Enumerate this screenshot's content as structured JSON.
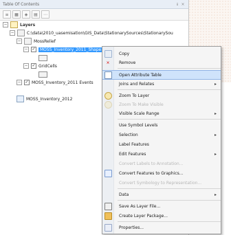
{
  "window": {
    "title": "Table Of Contents"
  },
  "tree": {
    "layers_label": "Layers",
    "path_label": "C:\\data\\2010_uasemisation\\GIS_Data\\StationarySources\\StationarySou",
    "mossrelief_label": "MossRelief",
    "selected_layer_label": "MOSS_Inventory_2011_Shape...",
    "gridcells_label": "GridCells",
    "layer_events_label": "MOSS_Inventory_2011 Events",
    "layer_plain_label": "MOSS_Inventory_2012"
  },
  "menu": {
    "items": [
      {
        "label": "Copy"
      },
      {
        "label": "Remove"
      },
      {
        "label": "Open Attribute Table"
      },
      {
        "label": "Joins and Relates"
      },
      {
        "label": "Zoom To Layer"
      },
      {
        "label": "Zoom To Make Visible"
      },
      {
        "label": "Visible Scale Range"
      },
      {
        "label": "Use Symbol Levels"
      },
      {
        "label": "Selection"
      },
      {
        "label": "Label Features"
      },
      {
        "label": "Edit Features"
      },
      {
        "label": "Convert Labels to Annotation..."
      },
      {
        "label": "Convert Features to Graphics..."
      },
      {
        "label": "Convert Symbology to Representation..."
      },
      {
        "label": "Data"
      },
      {
        "label": "Save As Layer File..."
      },
      {
        "label": "Create Layer Package..."
      },
      {
        "label": "Properties..."
      }
    ]
  },
  "colors": {
    "selection": "#3399ff",
    "menu_highlight": "#cfe3fb",
    "disabled_text": "#b7b7b7"
  }
}
